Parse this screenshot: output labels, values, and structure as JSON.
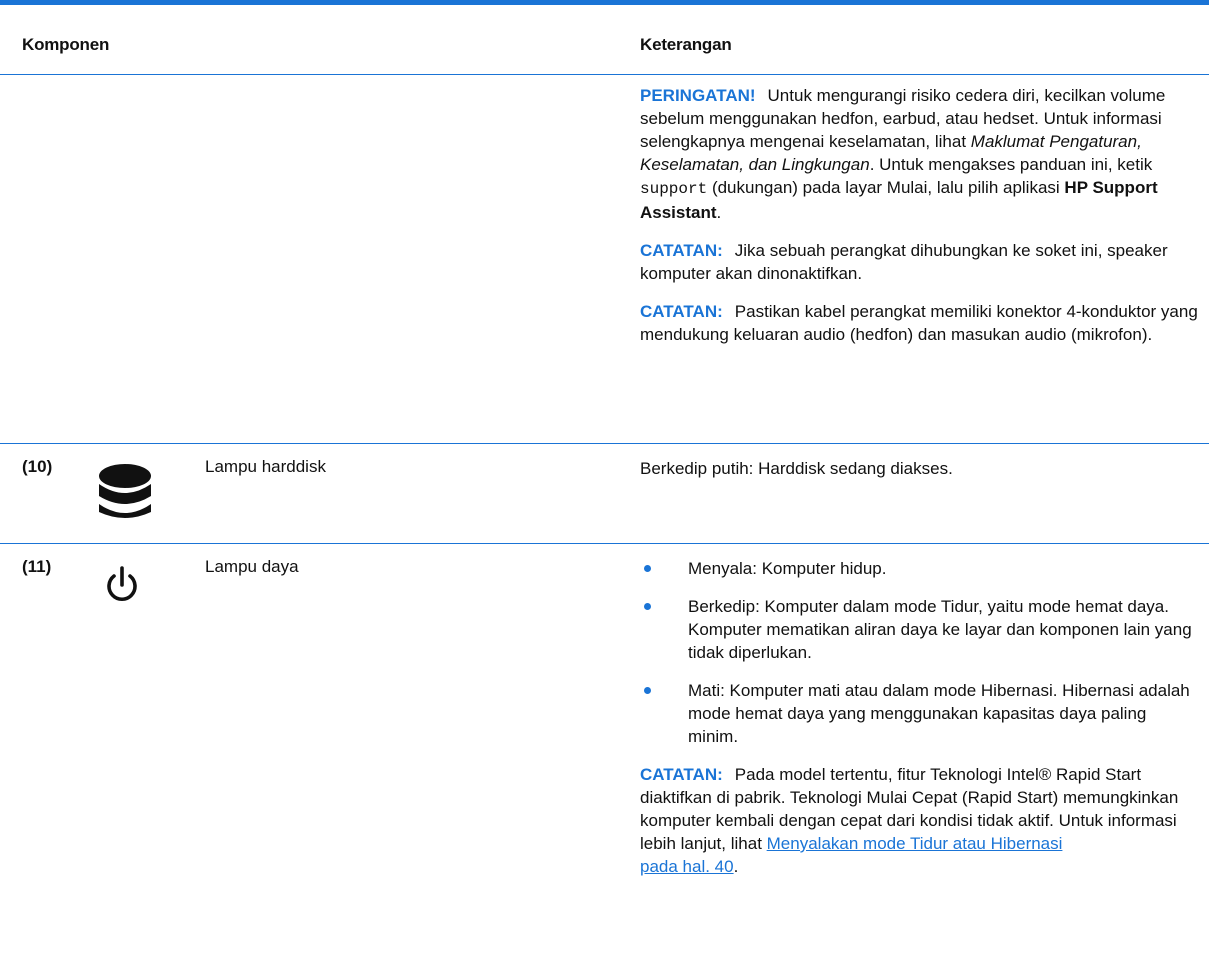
{
  "colors": {
    "accent": "#1a74d6",
    "text": "#111111"
  },
  "header": {
    "col_component": "Komponen",
    "col_description": "Keterangan"
  },
  "row_audio": {
    "warning": {
      "label": "PERINGATAN!",
      "text1": "Untuk mengurangi risiko cedera diri, kecilkan volume sebelum menggunakan hedfon, earbud, atau hedset. Untuk informasi selengkapnya mengenai keselamatan, lihat ",
      "italic": "Maklumat Pengaturan, Keselamatan, dan Lingkungan",
      "text2": ". Untuk mengakses panduan ini, ketik ",
      "code": "support",
      "text3": " (dukungan) pada layar Mulai, lalu pilih aplikasi ",
      "app": "HP Support Assistant",
      "end": "."
    },
    "note1": {
      "label": "CATATAN:",
      "text": "Jika sebuah perangkat dihubungkan ke soket ini, speaker komputer akan dinonaktifkan."
    },
    "note2": {
      "label": "CATATAN:",
      "text": "Pastikan kabel perangkat memiliki konektor 4-konduktor yang mendukung keluaran audio (hedfon) dan masukan audio (mikrofon)."
    }
  },
  "row10": {
    "number": "(10)",
    "icon": "hard-drive-icon",
    "name": "Lampu harddisk",
    "description": "Berkedip putih: Harddisk sedang diakses."
  },
  "row11": {
    "number": "(11)",
    "icon": "power-icon",
    "name": "Lampu daya",
    "bullets": [
      "Menyala: Komputer hidup.",
      "Berkedip: Komputer dalam mode Tidur, yaitu mode hemat daya. Komputer mematikan aliran daya ke layar dan komponen lain yang tidak diperlukan.",
      "Mati: Komputer mati atau dalam mode Hibernasi. Hibernasi adalah mode hemat daya yang menggunakan kapasitas daya paling minim."
    ],
    "note": {
      "label": "CATATAN:",
      "text": "Pada model tertentu, fitur Teknologi Intel® Rapid Start diaktifkan di pabrik. Teknologi Mulai Cepat (Rapid Start) memungkinkan komputer kembali dengan cepat dari kondisi tidak aktif. Untuk informasi lebih lanjut, lihat ",
      "link1": "Menyalakan mode Tidur atau Hibernasi",
      "link2": "pada hal. 40",
      "end": "."
    }
  }
}
